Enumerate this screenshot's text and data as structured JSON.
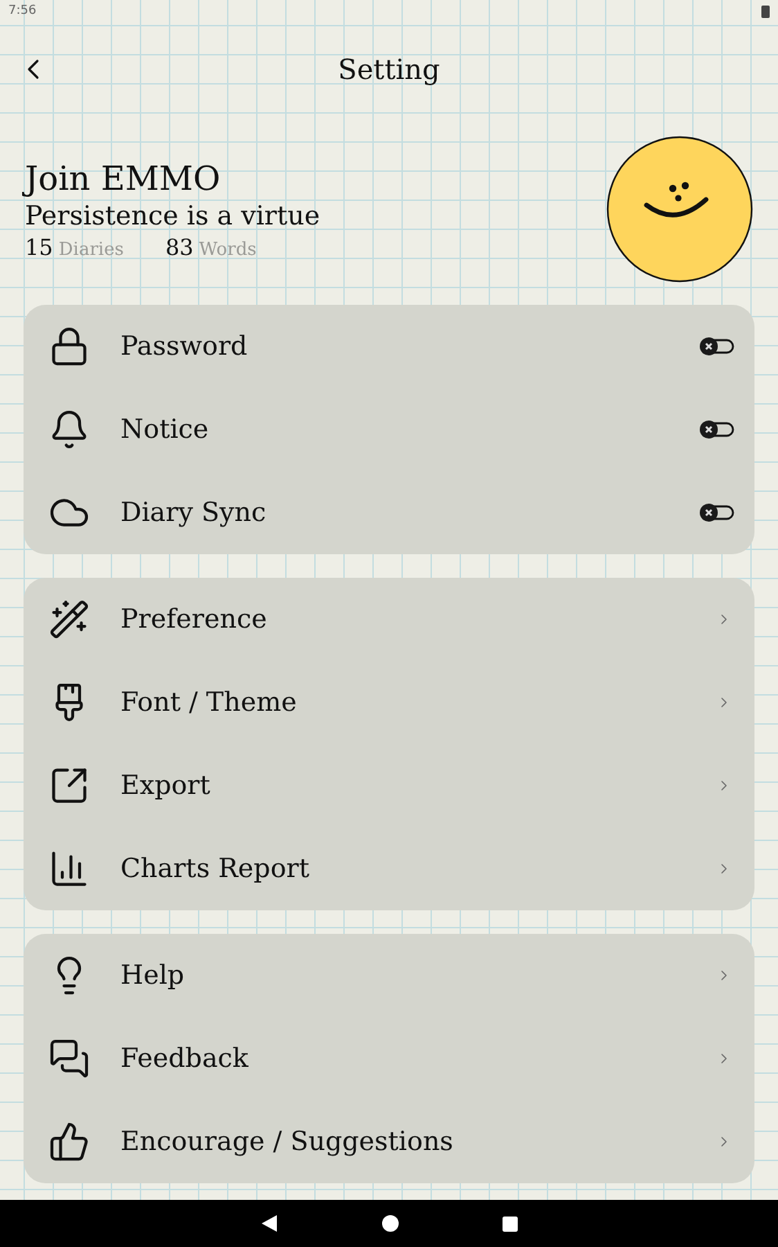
{
  "status_bar": {
    "time": "7:56"
  },
  "header": {
    "title": "Setting"
  },
  "profile": {
    "name": "Join EMMO",
    "motto": "Persistence is a virtue",
    "stats": [
      {
        "value": "15",
        "label": "Diaries"
      },
      {
        "value": "83",
        "label": "Words"
      }
    ]
  },
  "groups": [
    {
      "items": [
        {
          "kind": "toggle",
          "label": "Password",
          "on": false
        },
        {
          "kind": "toggle",
          "label": "Notice",
          "on": false
        },
        {
          "kind": "toggle",
          "label": "Diary Sync",
          "on": false
        }
      ]
    },
    {
      "items": [
        {
          "kind": "link",
          "label": "Preference"
        },
        {
          "kind": "link",
          "label": "Font / Theme"
        },
        {
          "kind": "link",
          "label": "Export"
        },
        {
          "kind": "link",
          "label": "Charts Report"
        }
      ]
    },
    {
      "items": [
        {
          "kind": "link",
          "label": "Help"
        },
        {
          "kind": "link",
          "label": "Feedback"
        },
        {
          "kind": "link",
          "label": "Encourage / Suggestions"
        }
      ]
    }
  ]
}
